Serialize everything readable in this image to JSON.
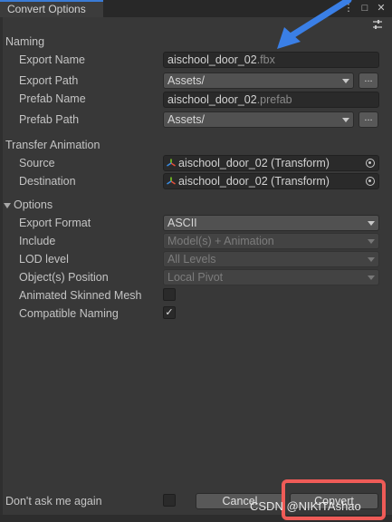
{
  "window": {
    "title": "Convert Options",
    "controls": [
      "⋮",
      "□",
      "✕"
    ]
  },
  "naming": {
    "header": "Naming",
    "export_name_label": "Export Name",
    "export_name_value": "aischool_door_02",
    "export_name_ext": ".fbx",
    "export_path_label": "Export Path",
    "export_path_value": "Assets/",
    "prefab_name_label": "Prefab Name",
    "prefab_name_value": "aischool_door_02",
    "prefab_name_ext": ".prefab",
    "prefab_path_label": "Prefab Path",
    "prefab_path_value": "Assets/",
    "browse_label": "..."
  },
  "transfer": {
    "header": "Transfer Animation",
    "source_label": "Source",
    "source_value": "aischool_door_02 (Transform)",
    "destination_label": "Destination",
    "destination_value": "aischool_door_02 (Transform)"
  },
  "options": {
    "header": "Options",
    "export_format_label": "Export Format",
    "export_format_value": "ASCII",
    "include_label": "Include",
    "include_value": "Model(s) + Animation",
    "lod_label": "LOD level",
    "lod_value": "All Levels",
    "position_label": "Object(s) Position",
    "position_value": "Local Pivot",
    "animated_skinned_label": "Animated Skinned Mesh",
    "animated_skinned_checked": false,
    "compatible_naming_label": "Compatible Naming",
    "compatible_naming_checked": true,
    "checkmark": "✓"
  },
  "footer": {
    "dont_ask_label": "Don't ask me again",
    "dont_ask_checked": false,
    "cancel_label": "Cancel",
    "convert_label": "Convert"
  },
  "watermark": "CSDN @NIKITAshao",
  "colors": {
    "annotation_arrow": "#3a7fe6",
    "highlight_box": "#ef5b57",
    "tab_accent": "#3a7bd5"
  }
}
